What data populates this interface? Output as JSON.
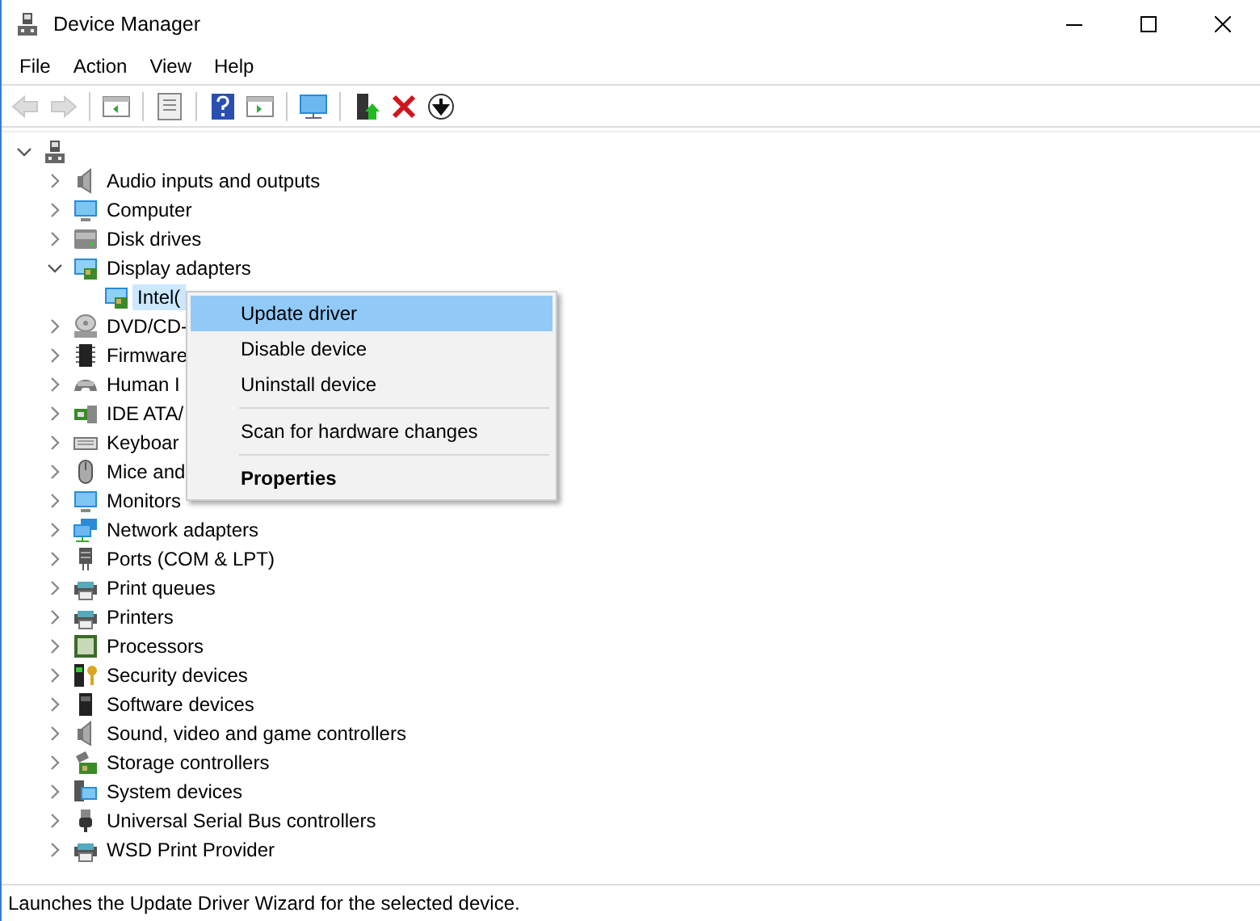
{
  "window": {
    "title": "Device Manager"
  },
  "menu_bar": [
    "File",
    "Action",
    "View",
    "Help"
  ],
  "toolbar": [
    {
      "kind": "back",
      "disabled": true
    },
    {
      "kind": "forward",
      "disabled": true
    },
    {
      "kind": "sep"
    },
    {
      "kind": "tree",
      "disabled": false
    },
    {
      "kind": "sep"
    },
    {
      "kind": "properties",
      "disabled": false
    },
    {
      "kind": "sep"
    },
    {
      "kind": "help",
      "disabled": false
    },
    {
      "kind": "pane",
      "disabled": false
    },
    {
      "kind": "sep"
    },
    {
      "kind": "scan",
      "disabled": false
    },
    {
      "kind": "sep"
    },
    {
      "kind": "update",
      "disabled": false
    },
    {
      "kind": "uninstall",
      "disabled": false
    },
    {
      "kind": "disable",
      "disabled": false
    }
  ],
  "tree": {
    "kind": "computer",
    "expanded": true,
    "children": [
      {
        "label": "Audio inputs and outputs",
        "kind": "audio",
        "expanded": false,
        "selected": false
      },
      {
        "label": "Computer",
        "kind": "computer2",
        "expanded": false,
        "selected": false
      },
      {
        "label": "Disk drives",
        "kind": "disk",
        "expanded": false,
        "selected": false
      },
      {
        "label": "Display adapters",
        "kind": "display",
        "expanded": true,
        "selected": false,
        "children": [
          {
            "label": "Intel(",
            "kind": "display",
            "selected": true
          }
        ]
      },
      {
        "label": "DVD/CD-",
        "kind": "dvd",
        "expanded": false,
        "selected": false
      },
      {
        "label": "Firmware",
        "kind": "firmware",
        "expanded": false,
        "selected": false
      },
      {
        "label": "Human I",
        "kind": "hid",
        "expanded": false,
        "selected": false
      },
      {
        "label": "IDE ATA/",
        "kind": "ide",
        "expanded": false,
        "selected": false
      },
      {
        "label": "Keyboar",
        "kind": "keyboard",
        "expanded": false,
        "selected": false
      },
      {
        "label": "Mice and",
        "kind": "mouse",
        "expanded": false,
        "selected": false
      },
      {
        "label": "Monitors",
        "kind": "monitor",
        "expanded": false,
        "selected": false
      },
      {
        "label": "Network adapters",
        "kind": "network",
        "expanded": false,
        "selected": false
      },
      {
        "label": "Ports (COM & LPT)",
        "kind": "port",
        "expanded": false,
        "selected": false
      },
      {
        "label": "Print queues",
        "kind": "printer",
        "expanded": false,
        "selected": false
      },
      {
        "label": "Printers",
        "kind": "printer",
        "expanded": false,
        "selected": false
      },
      {
        "label": "Processors",
        "kind": "processor",
        "expanded": false,
        "selected": false
      },
      {
        "label": "Security devices",
        "kind": "security",
        "expanded": false,
        "selected": false
      },
      {
        "label": "Software devices",
        "kind": "software",
        "expanded": false,
        "selected": false
      },
      {
        "label": "Sound, video and game controllers",
        "kind": "audio",
        "expanded": false,
        "selected": false
      },
      {
        "label": "Storage controllers",
        "kind": "storage",
        "expanded": false,
        "selected": false
      },
      {
        "label": "System devices",
        "kind": "system",
        "expanded": false,
        "selected": false
      },
      {
        "label": "Universal Serial Bus controllers",
        "kind": "usb",
        "expanded": false,
        "selected": false
      },
      {
        "label": "WSD Print Provider",
        "kind": "printer",
        "expanded": false,
        "selected": false
      }
    ]
  },
  "context_menu": {
    "items": [
      {
        "kind": "item",
        "label": "Update driver",
        "selected": true,
        "default": false
      },
      {
        "kind": "item",
        "label": "Disable device",
        "selected": false,
        "default": false
      },
      {
        "kind": "item",
        "label": "Uninstall device",
        "selected": false,
        "default": false
      },
      {
        "kind": "separator"
      },
      {
        "kind": "item",
        "label": "Scan for hardware changes",
        "selected": false,
        "default": false
      },
      {
        "kind": "separator"
      },
      {
        "kind": "item",
        "label": "Properties",
        "selected": false,
        "default": true
      }
    ]
  },
  "status_bar": "Launches the Update Driver Wizard for the selected device."
}
